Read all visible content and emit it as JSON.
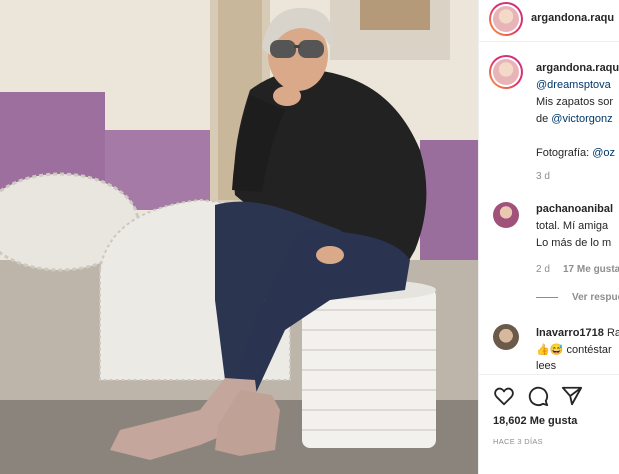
{
  "header": {
    "username": "argandona.raqu"
  },
  "caption": {
    "username": "argandona.raqu",
    "line1": "@dreamsptova",
    "line2": "Mis zapatos sor",
    "line3_prefix": "de ",
    "line3_link": "@victorgonz",
    "line4_prefix": "Fotografía: ",
    "line4_link": "@oz",
    "time": "3 d"
  },
  "comments": [
    {
      "username": "pachanoanibal",
      "lines": [
        "total. Mí amiga",
        "Lo más de lo m"
      ],
      "time": "2 d",
      "likes": "17 Me gusta",
      "view_replies": "Ver respue"
    },
    {
      "username": "lnavarro1718",
      "username_suffix": "Ra",
      "line1_text": "contéstar",
      "line2": "lees"
    }
  ],
  "footer": {
    "likes": "18,602 Me gusta",
    "posted_ago": "HACE 3 DÍAS"
  },
  "icons": [
    "heart-icon",
    "comment-icon",
    "share-icon",
    "thumbs-up-emoji",
    "grinning-emoji"
  ],
  "colors": {
    "link": "#00376b",
    "muted": "#8e8e8e",
    "wall_purple": "#9c6f9e"
  }
}
